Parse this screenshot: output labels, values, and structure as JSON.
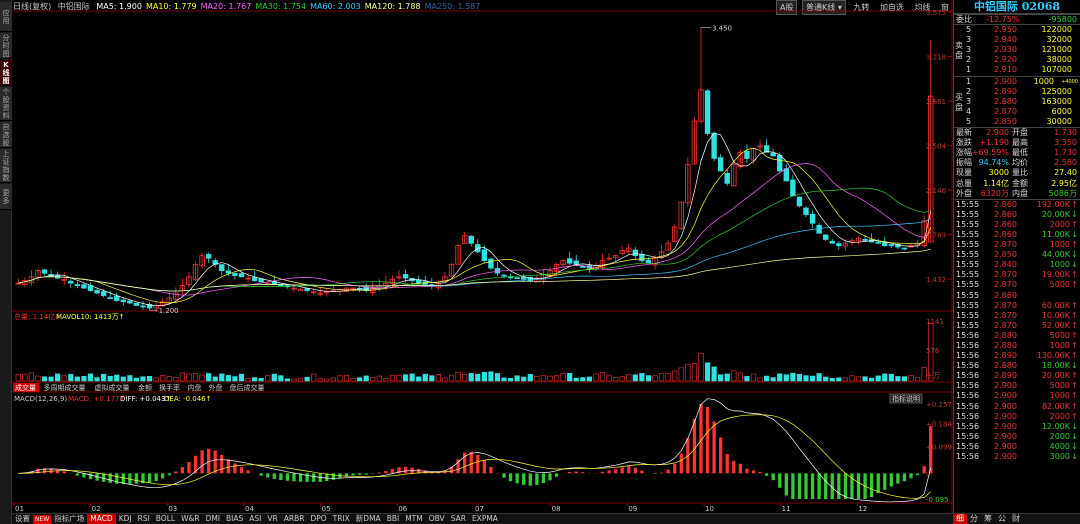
{
  "left_tabs": [
    {
      "label": "应用",
      "active": false
    },
    {
      "label": "分时图",
      "active": false
    },
    {
      "label": "K线图",
      "active": true
    },
    {
      "label": "个股资料",
      "active": false
    },
    {
      "label": "自选股",
      "active": false
    },
    {
      "label": "上证指数",
      "active": false
    },
    {
      "label": "更多",
      "active": false
    }
  ],
  "header": {
    "period": "日线(复权)",
    "name": "中铝国际",
    "ma": [
      {
        "label": "MA5: 1.900",
        "color": "#ffffff"
      },
      {
        "label": "MA10: 1.779",
        "color": "#ffff33"
      },
      {
        "label": "MA20: 1.767",
        "color": "#ff66ff"
      },
      {
        "label": "MA30: 1.754",
        "color": "#33cc33"
      },
      {
        "label": "MA60: 2.003",
        "color": "#33ccff"
      },
      {
        "label": "MA120: 1.788",
        "color": "#ffff99"
      },
      {
        "label": "MA250: 1.587",
        "color": "#336699"
      }
    ]
  },
  "toolbar": {
    "a_share": "A股",
    "mode": "普通K线 ▾",
    "nine": "九转",
    "add_fav": "加自选",
    "avg_line": "均线",
    "close": "窗"
  },
  "price_axis": [
    "3.575",
    "3.218",
    "2.861",
    "2.504",
    "2.146",
    "1.789",
    "1.432"
  ],
  "annotations": {
    "high": "3.450",
    "low": "1.200"
  },
  "volume_header": {
    "total": "总量: 1.14亿↑",
    "mavol": "MAVOL10: 1413万↑"
  },
  "volume_axis": [
    "1141",
    "576",
    "十万"
  ],
  "indicator_tabs": [
    {
      "label": "成交量",
      "active": true
    },
    {
      "label": "多周期成交量",
      "active": false
    },
    {
      "label": "虚拟成交量",
      "active": false
    },
    {
      "label": "金额",
      "active": false
    },
    {
      "label": "换手率",
      "active": false
    },
    {
      "label": "内盘",
      "active": false
    },
    {
      "label": "外盘",
      "active": false
    },
    {
      "label": "盘后成交量",
      "active": false
    }
  ],
  "macd_header": {
    "name": "MACD(12,26,9)",
    "macd": "MACD: +0.177↑",
    "diff": "DIFF: +0.043↑",
    "dea": "DEA: -0.046↑"
  },
  "macd_axis": [
    "+0.257",
    "+0.184",
    "+0.099",
    "0",
    "-0.095"
  ],
  "indicator_help": "指标说明",
  "month_labels": [
    "01",
    "02",
    "03",
    "04",
    "05",
    "06",
    "07",
    "08",
    "09",
    "10",
    "11",
    "12"
  ],
  "bottom_tabs": [
    {
      "label": "设置",
      "active": false
    },
    {
      "label": "NEW",
      "new": true
    },
    {
      "label": "指标广场",
      "active": false
    },
    {
      "label": "MACD",
      "active": true
    },
    {
      "label": "KDJ",
      "active": false
    },
    {
      "label": "RSI",
      "active": false
    },
    {
      "label": "BOLL",
      "active": false
    },
    {
      "label": "W&R",
      "active": false
    },
    {
      "label": "DMI",
      "active": false
    },
    {
      "label": "BIAS",
      "active": false
    },
    {
      "label": "ASI",
      "active": false
    },
    {
      "label": "VR",
      "active": false
    },
    {
      "label": "ARBR",
      "active": false
    },
    {
      "label": "DPO",
      "active": false
    },
    {
      "label": "TRIX",
      "active": false
    },
    {
      "label": "新DMA",
      "active": false
    },
    {
      "label": "BBI",
      "active": false
    },
    {
      "label": "MTM",
      "active": false
    },
    {
      "label": "OBV",
      "active": false
    },
    {
      "label": "SAR",
      "active": false
    },
    {
      "label": "EXPMA",
      "active": false
    }
  ],
  "quote": {
    "title": "中铝国际 02068",
    "ratio_label": "委比",
    "ratio_value": "-12.75%",
    "ratio_diff": "-95800",
    "sell_label": "卖盘",
    "buy_label": "买盘",
    "asks": [
      {
        "lvl": "5",
        "price": "2.950",
        "vol": "122000"
      },
      {
        "lvl": "3",
        "price": "2.940",
        "vol": "32000"
      },
      {
        "lvl": "3",
        "price": "2.930",
        "vol": "121000"
      },
      {
        "lvl": "2",
        "price": "2.920",
        "vol": "38000"
      },
      {
        "lvl": "1",
        "price": "2.910",
        "vol": "107000"
      }
    ],
    "bids": [
      {
        "lvl": "1",
        "price": "2.900",
        "vol": "1000",
        "extra": "+4000"
      },
      {
        "lvl": "2",
        "price": "2.890",
        "vol": "125000",
        "extra": ""
      },
      {
        "lvl": "3",
        "price": "2.880",
        "vol": "163000",
        "extra": ""
      },
      {
        "lvl": "4",
        "price": "2.870",
        "vol": "6000",
        "extra": ""
      },
      {
        "lvl": "5",
        "price": "2.850",
        "vol": "30000",
        "extra": ""
      }
    ],
    "stats": [
      {
        "l1": "最新",
        "v1": "2.900",
        "l2": "开盘",
        "v2": "1.730",
        "c1": "r",
        "c2": "r"
      },
      {
        "l1": "涨跌",
        "v1": "+1.190",
        "l2": "最高",
        "v2": "3.350",
        "c1": "r",
        "c2": "r"
      },
      {
        "l1": "涨幅",
        "v1": "+69.59%",
        "l2": "最低",
        "v2": "1.730",
        "c1": "r",
        "c2": "r"
      },
      {
        "l1": "振幅",
        "v1": "94.74%",
        "l2": "均价",
        "v2": "2.580",
        "c1": "c",
        "c2": "r"
      },
      {
        "l1": "现量",
        "v1": "3000",
        "l2": "量比",
        "v2": "27.40",
        "c1": "y",
        "c2": "y"
      },
      {
        "l1": "总量",
        "v1": "1.14亿",
        "l2": "金额",
        "v2": "2.95亿",
        "c1": "y",
        "c2": "y"
      },
      {
        "l1": "外盘",
        "v1": "6320万",
        "l2": "内盘",
        "v2": "5086万",
        "c1": "r",
        "c2": "gr"
      }
    ],
    "ticks": [
      {
        "t": "15:55",
        "p": "2.860",
        "v": "192.00K",
        "d": "up"
      },
      {
        "t": "15:55",
        "p": "2.860",
        "v": "20.00K",
        "d": "down"
      },
      {
        "t": "15:55",
        "p": "2.860",
        "v": "2000",
        "d": "up"
      },
      {
        "t": "15:55",
        "p": "2.860",
        "v": "11.00K",
        "d": "down"
      },
      {
        "t": "15:55",
        "p": "2.870",
        "v": "1000",
        "d": "up"
      },
      {
        "t": "15:55",
        "p": "2.850",
        "v": "44.00K",
        "d": "down"
      },
      {
        "t": "15:55",
        "p": "2.840",
        "v": "1000",
        "d": "down"
      },
      {
        "t": "15:55",
        "p": "2.870",
        "v": "19.00K",
        "d": "up"
      },
      {
        "t": "15:55",
        "p": "2.870",
        "v": "5000",
        "d": "up"
      },
      {
        "t": "15:55",
        "p": "2.860",
        "v": "",
        "d": ""
      },
      {
        "t": "15:55",
        "p": "2.870",
        "v": "60.00K",
        "d": "up"
      },
      {
        "t": "15:55",
        "p": "2.870",
        "v": "10.00K",
        "d": "up"
      },
      {
        "t": "15:55",
        "p": "2.870",
        "v": "52.00K",
        "d": "up"
      },
      {
        "t": "15:56",
        "p": "2.880",
        "v": "5000",
        "d": "up"
      },
      {
        "t": "15:56",
        "p": "2.880",
        "v": "1000",
        "d": "up"
      },
      {
        "t": "15:56",
        "p": "2.890",
        "v": "130.00K",
        "d": "up"
      },
      {
        "t": "15:56",
        "p": "2.880",
        "v": "18.00K",
        "d": "down"
      },
      {
        "t": "15:56",
        "p": "2.890",
        "v": "20.00K",
        "d": "up"
      },
      {
        "t": "15:56",
        "p": "2.900",
        "v": "5000",
        "d": "up"
      },
      {
        "t": "15:56",
        "p": "2.900",
        "v": "1000",
        "d": "up"
      },
      {
        "t": "15:56",
        "p": "2.900",
        "v": "82.00K",
        "d": "up"
      },
      {
        "t": "15:56",
        "p": "2.900",
        "v": "2000",
        "d": "up"
      },
      {
        "t": "15:56",
        "p": "2.900",
        "v": "12.00K",
        "d": "down"
      },
      {
        "t": "15:56",
        "p": "2.900",
        "v": "2000",
        "d": "down"
      },
      {
        "t": "15:56",
        "p": "2.900",
        "v": "4000",
        "d": "down"
      },
      {
        "t": "15:56",
        "p": "2.900",
        "v": "3000",
        "d": "down"
      }
    ],
    "footer_tabs": [
      {
        "label": "细",
        "active": true
      },
      {
        "label": "分",
        "active": false
      },
      {
        "label": "筹",
        "active": false
      },
      {
        "label": "公",
        "active": false
      },
      {
        "label": "财",
        "active": false
      }
    ]
  },
  "chart_data": {
    "type": "candlestick",
    "note_series": "daily K-line with MA overlays, volume and MACD",
    "ylim": [
      1.2,
      3.575
    ],
    "closes": [
      1.4,
      1.42,
      1.45,
      1.5,
      1.48,
      1.46,
      1.44,
      1.43,
      1.4,
      1.38,
      1.36,
      1.34,
      1.32,
      1.3,
      1.28,
      1.26,
      1.25,
      1.24,
      1.22,
      1.21,
      1.2,
      1.22,
      1.25,
      1.28,
      1.32,
      1.38,
      1.45,
      1.55,
      1.62,
      1.6,
      1.55,
      1.5,
      1.48,
      1.46,
      1.45,
      1.44,
      1.42,
      1.41,
      1.4,
      1.39,
      1.38,
      1.37,
      1.36,
      1.35,
      1.34,
      1.33,
      1.32,
      1.33,
      1.34,
      1.35,
      1.36,
      1.36,
      1.35,
      1.34,
      1.36,
      1.38,
      1.4,
      1.43,
      1.45,
      1.44,
      1.42,
      1.4,
      1.39,
      1.38,
      1.4,
      1.45,
      1.55,
      1.7,
      1.78,
      1.72,
      1.65,
      1.58,
      1.52,
      1.48,
      1.46,
      1.45,
      1.44,
      1.43,
      1.42,
      1.44,
      1.47,
      1.5,
      1.55,
      1.58,
      1.56,
      1.55,
      1.53,
      1.52,
      1.54,
      1.58,
      1.6,
      1.62,
      1.66,
      1.68,
      1.62,
      1.58,
      1.56,
      1.6,
      1.65,
      1.72,
      1.85,
      2.05,
      2.35,
      2.7,
      2.95,
      2.6,
      2.4,
      2.3,
      2.2,
      2.35,
      2.45,
      2.4,
      2.48,
      2.5,
      2.45,
      2.42,
      2.3,
      2.22,
      2.1,
      2.02,
      1.95,
      1.88,
      1.8,
      1.75,
      1.72,
      1.7,
      1.72,
      1.74,
      1.76,
      1.75,
      1.73,
      1.72,
      1.7,
      1.7,
      1.69,
      1.68,
      1.7,
      1.72,
      1.9,
      2.9
    ],
    "volume_axis_max": 1141,
    "macd_range": [
      -0.095,
      0.257
    ]
  }
}
